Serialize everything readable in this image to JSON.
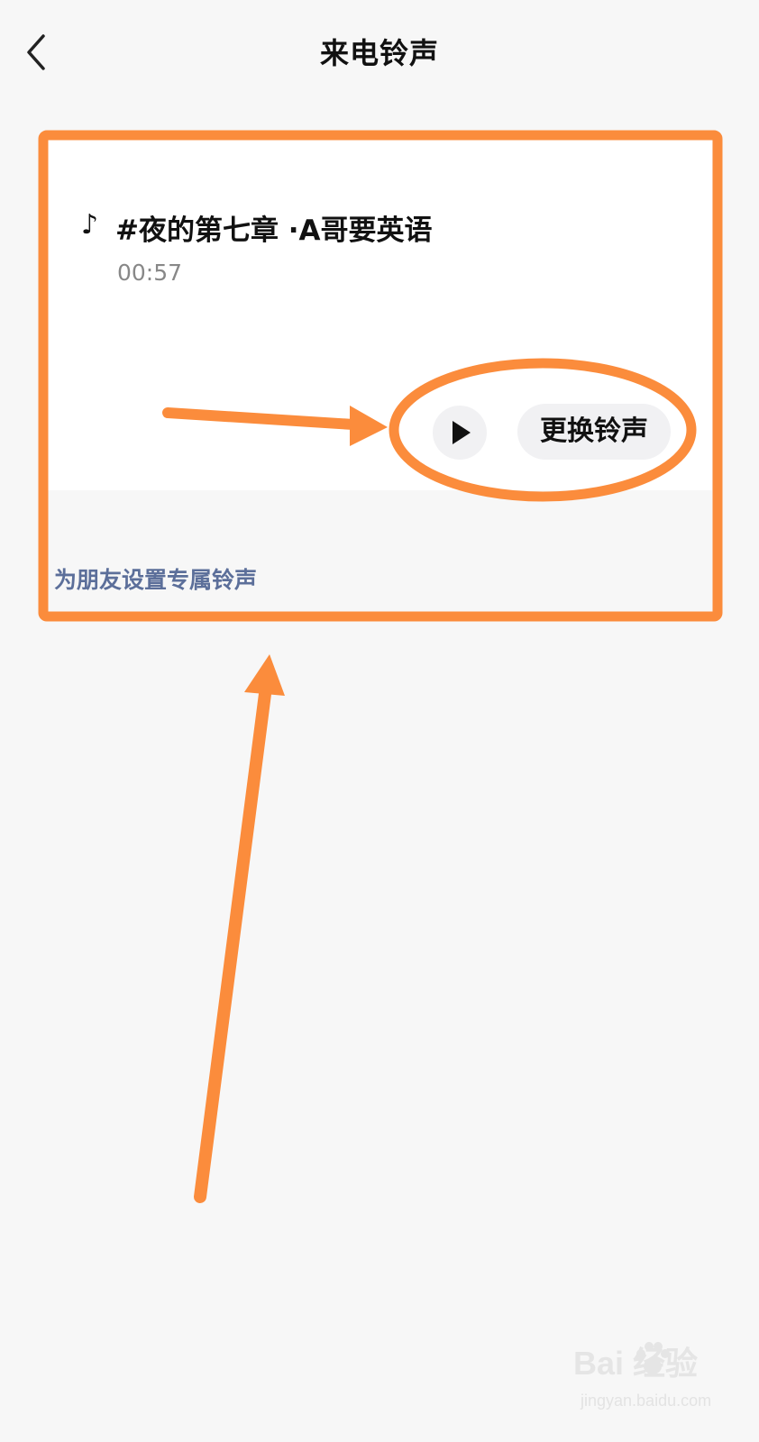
{
  "header": {
    "title": "来电铃声",
    "back_icon": "chevron-left-icon"
  },
  "ringtone": {
    "note_icon": "♪",
    "title": "#夜的第七章 ·A哥要英语",
    "duration": "00:57",
    "play_icon": "play-icon",
    "change_label": "更换铃声"
  },
  "friend_section": {
    "label": "为朋友设置专属铃声"
  },
  "watermark": {
    "brand": "Bai  经验",
    "url": "jingyan.baidu.com"
  },
  "colors": {
    "annotation": "#fb8c3c",
    "link_text": "#5c6f9a",
    "background": "#f7f7f7"
  }
}
